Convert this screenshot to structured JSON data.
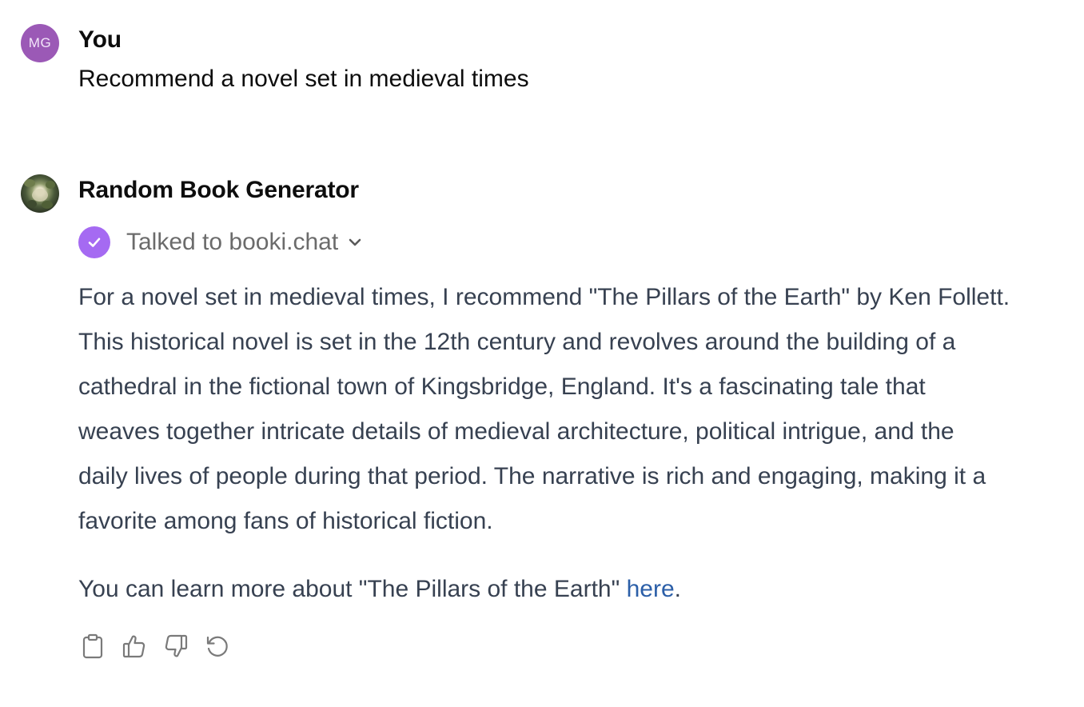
{
  "user_message": {
    "avatar_initials": "MG",
    "author": "You",
    "text": "Recommend a novel set in medieval times"
  },
  "bot_message": {
    "author": "Random Book Generator",
    "avatar_icon": "gpt-avatar-image",
    "tool_call": {
      "label": "Talked to booki.chat",
      "status_icon": "check-circle-icon",
      "expand_icon": "chevron-down-icon"
    },
    "paragraph_lines": [
      "For a novel set in medieval times, I recommend \"The Pillars of the Earth\" by Ken Follett.",
      "This historical novel is set in the 12th century and revolves around the building of a",
      "cathedral in the fictional town of Kingsbridge, England. It's a fascinating tale that",
      "weaves together intricate details of medieval architecture, political intrigue, and the",
      "daily lives of people during that period. The narrative is rich and engaging, making it a",
      "favorite among fans of historical fiction."
    ],
    "followup_prefix": "You can learn more about \"The Pillars of the Earth\" ",
    "followup_link": "here",
    "followup_suffix": ".",
    "actions": [
      "copy-icon",
      "thumbs-up-icon",
      "thumbs-down-icon",
      "regenerate-icon"
    ]
  },
  "colors": {
    "user_avatar": "#9b59b6",
    "tool_badge": "#a56af2",
    "link": "#2c5fa8",
    "body_text": "#374151"
  }
}
